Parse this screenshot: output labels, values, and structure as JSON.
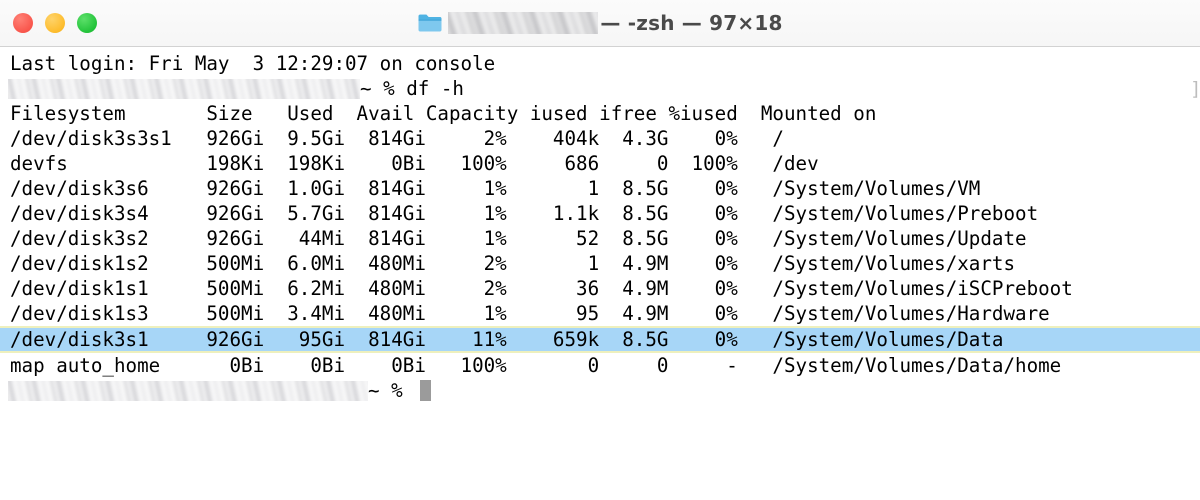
{
  "window": {
    "traffic_lights": [
      {
        "name": "close",
        "color": "#f9564c"
      },
      {
        "name": "minimize",
        "color": "#fdbc2c"
      },
      {
        "name": "maximize",
        "color": "#23c33a"
      }
    ],
    "folder_icon": "folder-icon",
    "title_redacted": true,
    "title_text": "— -zsh — 97×18",
    "shell": "-zsh",
    "cols": 97,
    "rows": 18
  },
  "terminal": {
    "login_line": "Last login: Fri May  3 12:29:07 on console",
    "command_line": {
      "prompt_redacted": true,
      "prompt_tail": "~ % ",
      "command": "df -h"
    },
    "final_prompt": {
      "prompt_redacted": true,
      "prompt_tail": "~ % ",
      "cursor": "block-cursor"
    },
    "edge_artifact": "]",
    "highlight_color": "#a7d6f7",
    "highlight_border_color": "#eef0bd"
  },
  "table": {
    "columns": [
      "Filesystem",
      "Size",
      "Used",
      "Avail",
      "Capacity",
      "iused",
      "ifree",
      "%iused",
      "Mounted on"
    ],
    "header_text": "Filesystem       Size   Used  Avail Capacity iused ifree %iused  Mounted on",
    "rows": [
      {
        "text": "/dev/disk3s3s1   926Gi  9.5Gi  814Gi     2%    404k  4.3G    0%   /",
        "filesystem": "/dev/disk3s3s1",
        "size": "926Gi",
        "used": "9.5Gi",
        "avail": "814Gi",
        "capacity": "2%",
        "iused": "404k",
        "ifree": "4.3G",
        "piused": "0%",
        "mounted_on": "/",
        "highlighted": false
      },
      {
        "text": "devfs            198Ki  198Ki    0Bi   100%     686     0  100%   /dev",
        "filesystem": "devfs",
        "size": "198Ki",
        "used": "198Ki",
        "avail": "0Bi",
        "capacity": "100%",
        "iused": "686",
        "ifree": "0",
        "piused": "100%",
        "mounted_on": "/dev",
        "highlighted": false
      },
      {
        "text": "/dev/disk3s6     926Gi  1.0Gi  814Gi     1%       1  8.5G    0%   /System/Volumes/VM",
        "filesystem": "/dev/disk3s6",
        "size": "926Gi",
        "used": "1.0Gi",
        "avail": "814Gi",
        "capacity": "1%",
        "iused": "1",
        "ifree": "8.5G",
        "piused": "0%",
        "mounted_on": "/System/Volumes/VM",
        "highlighted": false
      },
      {
        "text": "/dev/disk3s4     926Gi  5.7Gi  814Gi     1%    1.1k  8.5G    0%   /System/Volumes/Preboot",
        "filesystem": "/dev/disk3s4",
        "size": "926Gi",
        "used": "5.7Gi",
        "avail": "814Gi",
        "capacity": "1%",
        "iused": "1.1k",
        "ifree": "8.5G",
        "piused": "0%",
        "mounted_on": "/System/Volumes/Preboot",
        "highlighted": false
      },
      {
        "text": "/dev/disk3s2     926Gi   44Mi  814Gi     1%      52  8.5G    0%   /System/Volumes/Update",
        "filesystem": "/dev/disk3s2",
        "size": "926Gi",
        "used": "44Mi",
        "avail": "814Gi",
        "capacity": "1%",
        "iused": "52",
        "ifree": "8.5G",
        "piused": "0%",
        "mounted_on": "/System/Volumes/Update",
        "highlighted": false
      },
      {
        "text": "/dev/disk1s2     500Mi  6.0Mi  480Mi     2%       1  4.9M    0%   /System/Volumes/xarts",
        "filesystem": "/dev/disk1s2",
        "size": "500Mi",
        "used": "6.0Mi",
        "avail": "480Mi",
        "capacity": "2%",
        "iused": "1",
        "ifree": "4.9M",
        "piused": "0%",
        "mounted_on": "/System/Volumes/xarts",
        "highlighted": false
      },
      {
        "text": "/dev/disk1s1     500Mi  6.2Mi  480Mi     2%      36  4.9M    0%   /System/Volumes/iSCPreboot",
        "filesystem": "/dev/disk1s1",
        "size": "500Mi",
        "used": "6.2Mi",
        "avail": "480Mi",
        "capacity": "2%",
        "iused": "36",
        "ifree": "4.9M",
        "piused": "0%",
        "mounted_on": "/System/Volumes/iSCPreboot",
        "highlighted": false
      },
      {
        "text": "/dev/disk1s3     500Mi  3.4Mi  480Mi     1%      95  4.9M    0%   /System/Volumes/Hardware",
        "filesystem": "/dev/disk1s3",
        "size": "500Mi",
        "used": "3.4Mi",
        "avail": "480Mi",
        "capacity": "1%",
        "iused": "95",
        "ifree": "4.9M",
        "piused": "0%",
        "mounted_on": "/System/Volumes/Hardware",
        "highlighted": false
      },
      {
        "text": "/dev/disk3s1     926Gi   95Gi  814Gi    11%    659k  8.5G    0%   /System/Volumes/Data",
        "filesystem": "/dev/disk3s1",
        "size": "926Gi",
        "used": "95Gi",
        "avail": "814Gi",
        "capacity": "11%",
        "iused": "659k",
        "ifree": "8.5G",
        "piused": "0%",
        "mounted_on": "/System/Volumes/Data",
        "highlighted": true
      },
      {
        "text": "map auto_home      0Bi    0Bi    0Bi   100%       0     0     -   /System/Volumes/Data/home",
        "filesystem": "map auto_home",
        "size": "0Bi",
        "used": "0Bi",
        "avail": "0Bi",
        "capacity": "100%",
        "iused": "0",
        "ifree": "0",
        "piused": "-",
        "mounted_on": "/System/Volumes/Data/home",
        "highlighted": false
      }
    ]
  }
}
